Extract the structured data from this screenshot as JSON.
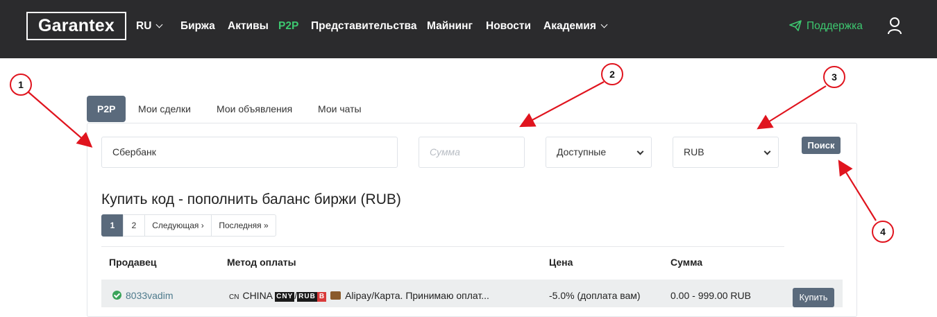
{
  "header": {
    "logo": "Garantex",
    "nav": [
      {
        "label": "RU",
        "dropdown": true
      },
      {
        "label": "Биржа"
      },
      {
        "label": "Активы"
      },
      {
        "label": "P2P",
        "active": true
      },
      {
        "label": "Представительства"
      },
      {
        "label": "Майнинг"
      },
      {
        "label": "Новости"
      },
      {
        "label": "Академия",
        "dropdown": true
      }
    ],
    "support": "Поддержка",
    "user_icon": "user-icon",
    "accent_color": "#3dc870",
    "bg_color": "#2b2b2d"
  },
  "tabs": [
    "P2P",
    "Мои сделки",
    "Мои объявления",
    "Мои чаты"
  ],
  "filters": {
    "payment_value": "Сбербанк",
    "amount_placeholder": "Сумма",
    "availability_selected": "Доступные",
    "currency_selected": "RUB",
    "search_label": "Поиск"
  },
  "heading": "Купить код - пополнить баланс биржи (RUB)",
  "pagination": [
    "1",
    "2",
    "Следующая ›",
    "Последняя »"
  ],
  "table": {
    "columns": [
      "Продавец",
      "Метод оплаты",
      "Цена",
      "Сумма"
    ],
    "rows": [
      {
        "seller": "8033vadim",
        "flag": "CN",
        "country": "CHINA",
        "tag1": "CNY",
        "tag2": "RUB",
        "method": "Alipay/Карта. Принимаю оплат...",
        "price": "-5.0% (доплата вам)",
        "amount": "0.00 - 999.00 RUB",
        "action": "Купить"
      }
    ]
  },
  "annotations": [
    "1",
    "2",
    "3",
    "4"
  ],
  "annotation_color": "#e0141e"
}
